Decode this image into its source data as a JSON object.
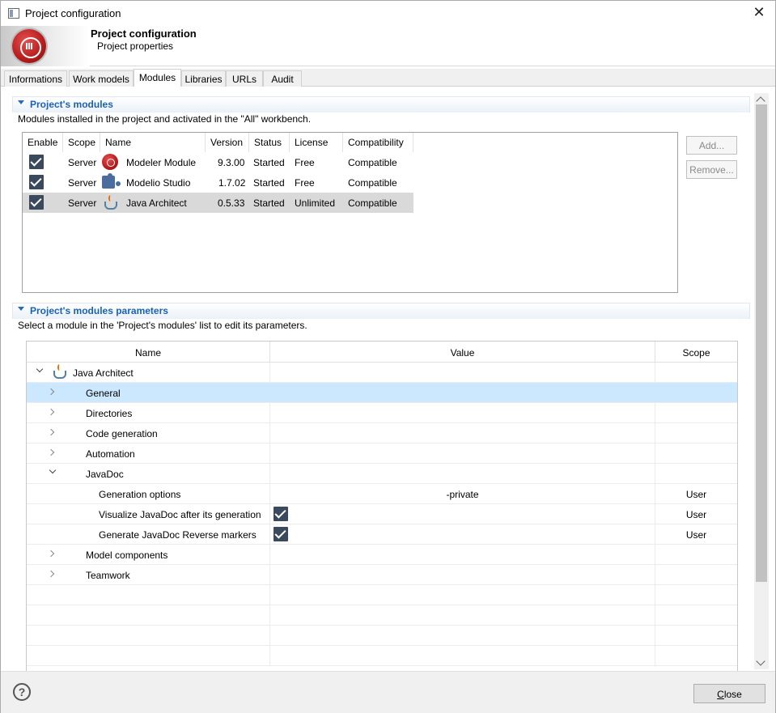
{
  "window": {
    "title": "Project configuration"
  },
  "banner": {
    "title": "Project configuration",
    "subtitle": "Project properties"
  },
  "tabs": [
    {
      "label": "Informations"
    },
    {
      "label": "Work models"
    },
    {
      "label": "Modules",
      "active": true
    },
    {
      "label": "Libraries"
    },
    {
      "label": "URLs"
    },
    {
      "label": "Audit"
    }
  ],
  "modules_section": {
    "title": "Project's modules",
    "description": "Modules installed in the project and activated in the \"All\" workbench.",
    "columns": [
      "Enable",
      "Scope",
      "Name",
      "Version",
      "Status",
      "License",
      "Compatibility"
    ],
    "rows": [
      {
        "enabled": true,
        "scope": "Server",
        "icon": "modeler-module-icon",
        "name": "Modeler Module",
        "version": "9.3.00",
        "status": "Started",
        "license": "Free",
        "compatibility": "Compatible"
      },
      {
        "enabled": true,
        "scope": "Server",
        "icon": "puzzle-icon",
        "name": "Modelio Studio",
        "version": "1.7.02",
        "status": "Started",
        "license": "Free",
        "compatibility": "Compatible"
      },
      {
        "enabled": true,
        "scope": "Server",
        "icon": "java-icon",
        "name": "Java Architect",
        "version": "0.5.33",
        "status": "Started",
        "license": "Unlimited",
        "compatibility": "Compatible",
        "selected": true
      }
    ],
    "buttons": {
      "add": "Add...",
      "remove": "Remove..."
    }
  },
  "params_section": {
    "title": "Project's modules parameters",
    "description": "Select a module in the 'Project's modules' list to edit its parameters.",
    "columns": {
      "name": "Name",
      "value": "Value",
      "scope": "Scope"
    },
    "rows": [
      {
        "name": "Java Architect",
        "expanded": true,
        "icon": "java-icon"
      },
      {
        "name": "General",
        "expanded": false,
        "selected": true
      },
      {
        "name": "Directories",
        "expanded": false
      },
      {
        "name": "Code generation",
        "expanded": false
      },
      {
        "name": "Automation",
        "expanded": false
      },
      {
        "name": "JavaDoc",
        "expanded": true
      },
      {
        "name": "Generation options",
        "value": "-private",
        "scope": "User"
      },
      {
        "name": "Visualize  JavaDoc after its generation",
        "checked": true,
        "scope": "User"
      },
      {
        "name": "Generate JavaDoc Reverse markers",
        "checked": true,
        "scope": "User"
      },
      {
        "name": "Model components",
        "expanded": false
      },
      {
        "name": "Teamwork",
        "expanded": false
      }
    ]
  },
  "footer": {
    "help": "?",
    "close_label": "Close",
    "close_mnemonic": "C",
    "close_rest": "lose"
  }
}
